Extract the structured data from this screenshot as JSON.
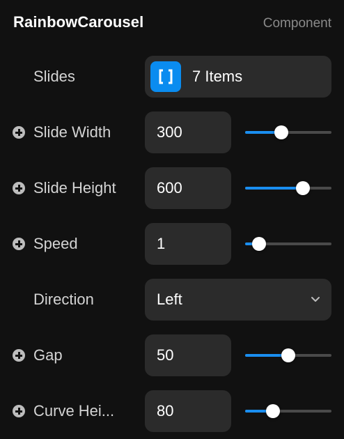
{
  "header": {
    "title": "RainbowCarousel",
    "tag": "Component"
  },
  "slides": {
    "label": "Slides",
    "value": "7 Items",
    "icon": "array-brackets-icon",
    "icon_color": "#0a8cf0"
  },
  "slide_width": {
    "label": "Slide Width",
    "value": "300",
    "slider_fraction": 0.42
  },
  "slide_height": {
    "label": "Slide Height",
    "value": "600",
    "slider_fraction": 0.67
  },
  "speed": {
    "label": "Speed",
    "value": "1",
    "slider_fraction": 0.16
  },
  "direction": {
    "label": "Direction",
    "value": "Left",
    "icon": "chevron-down-icon"
  },
  "gap": {
    "label": "Gap",
    "value": "50",
    "slider_fraction": 0.5
  },
  "curve_height": {
    "label": "Curve Hei...",
    "value": "80",
    "slider_fraction": 0.32
  },
  "colors": {
    "accent": "#1a8ef0",
    "background": "#111111",
    "field": "#2b2b2b"
  }
}
